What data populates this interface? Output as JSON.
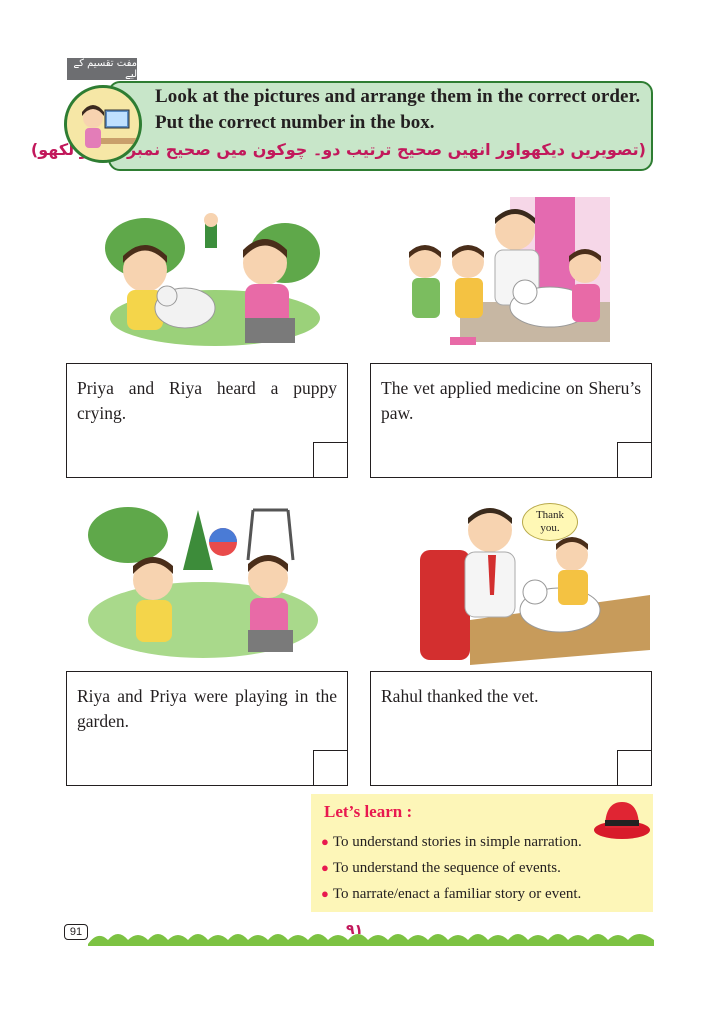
{
  "header": {
    "free_tag": "مفت تقسیم کے لیے",
    "line1": "Look at the pictures and arrange them in the correct order.",
    "line2": "Put the correct number in the box.",
    "urdu": "(تصویریں دیکھواور انھیں صحیح ترتیب دو۔ چوکون میں صحیح نمبر شمار لکھو)"
  },
  "cards": [
    {
      "text": "Priya and Riya heard a puppy crying."
    },
    {
      "text": "The vet applied medicine on Sheru’s paw."
    },
    {
      "text": "Riya and Priya were playing in the garden."
    },
    {
      "text": "Rahul thanked the vet."
    }
  ],
  "bubble": {
    "text": "Thank you."
  },
  "lets_learn": {
    "title": "Let’s learn :",
    "items": [
      "To understand stories in simple narration.",
      "To understand the sequence of events.",
      "To narrate/enact a familiar story or event."
    ]
  },
  "footer": {
    "page_number": "91",
    "urdu_page_number": "۹۱"
  }
}
